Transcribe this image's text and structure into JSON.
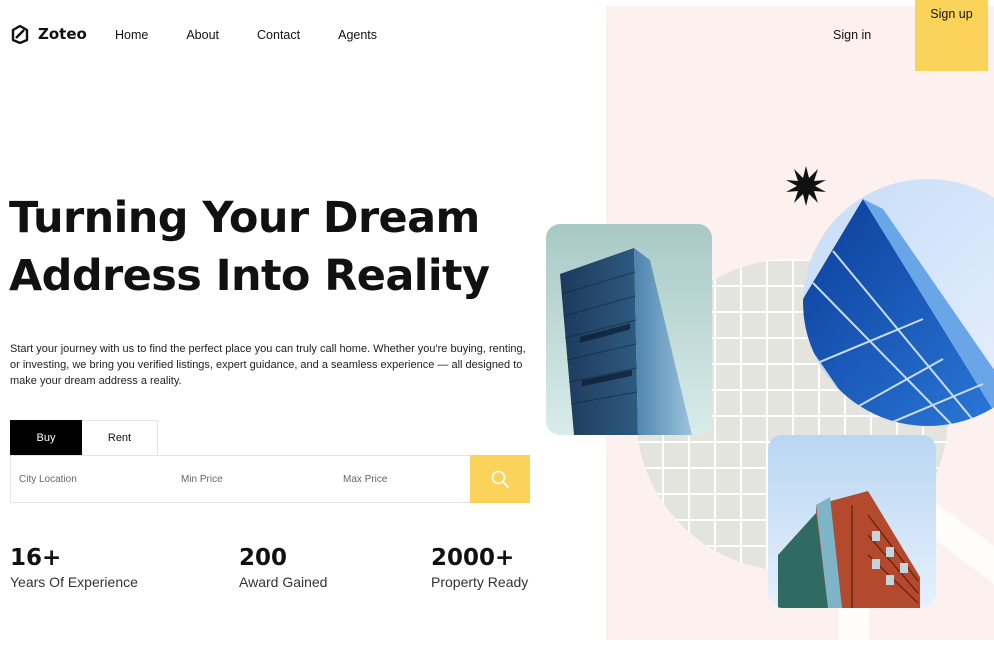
{
  "brand": {
    "name": "Zoteo",
    "icon": "logo-icon"
  },
  "nav": {
    "items": [
      "Home",
      "About",
      "Contact",
      "Agents"
    ],
    "sign_in": "Sign in",
    "sign_up": "Sign up"
  },
  "hero": {
    "title_line1": "Turning Your Dream",
    "title_line2": "Address Into Reality",
    "description": "Start your journey with us to find the perfect place you can truly call home. Whether you're buying, renting, or investing, we bring you verified listings, expert guidance, and a seamless experience — all designed to make your dream address a reality."
  },
  "search": {
    "tabs": [
      "Buy",
      "Rent"
    ],
    "active_tab": "Buy",
    "city_placeholder": "City Location",
    "min_price_placeholder": "Min Price",
    "max_price_placeholder": "Max Price",
    "button_icon": "search-icon"
  },
  "stats": [
    {
      "value": "16+",
      "label": "Years Of Experience"
    },
    {
      "value": "200",
      "label": "Award Gained"
    },
    {
      "value": "2000+",
      "label": "Property Ready"
    }
  ],
  "colors": {
    "accent": "#fbd25a",
    "right_panel": "#fdf1f0",
    "grid_circle": "#e4e4df",
    "text": "#111111"
  }
}
